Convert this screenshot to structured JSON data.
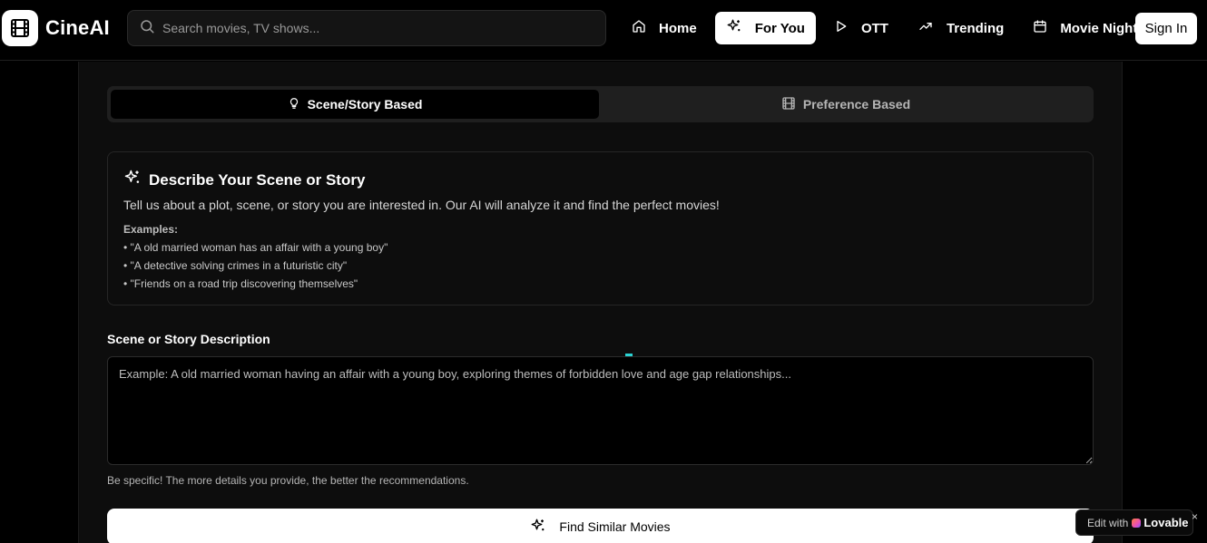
{
  "app": {
    "name": "CineAI"
  },
  "header": {
    "search_placeholder": "Search movies, TV shows...",
    "nav": [
      {
        "label": "Home",
        "icon": "home-icon",
        "active": false
      },
      {
        "label": "For You",
        "icon": "sparkles-icon",
        "active": true
      },
      {
        "label": "OTT",
        "icon": "play-icon",
        "active": false
      },
      {
        "label": "Trending",
        "icon": "trending-up-icon",
        "active": false
      },
      {
        "label": "Movie Night",
        "icon": "calendar-icon",
        "active": false
      }
    ],
    "sign_in": "Sign In"
  },
  "tabs": [
    {
      "label": "Scene/Story Based",
      "icon": "lightbulb-icon",
      "active": true
    },
    {
      "label": "Preference Based",
      "icon": "film-icon",
      "active": false
    }
  ],
  "card": {
    "title": "Describe Your Scene or Story",
    "description": "Tell us about a plot, scene, or story you are interested in. Our AI will analyze it and find the perfect movies!",
    "examples_label": "Examples:",
    "examples": [
      "• \"A old married woman has an affair with a young boy\"",
      "• \"A detective solving crimes in a futuristic city\"",
      "• \"Friends on a road trip discovering themselves\""
    ]
  },
  "form": {
    "label": "Scene or Story Description",
    "placeholder": "Example: A old married woman having an affair with a young boy, exploring themes of forbidden love and age gap relationships...",
    "value": "",
    "hint": "Be specific! The more details you provide, the better the recommendations.",
    "submit": "Find Similar Movies"
  },
  "badge": {
    "prefix": "Edit with",
    "brand": "Lovable",
    "close": "×"
  },
  "colors": {
    "background": "#000000",
    "panel": "#0d0d0d",
    "tab_track": "#1f1f1f",
    "accent_cursor": "#2bd4d4"
  }
}
